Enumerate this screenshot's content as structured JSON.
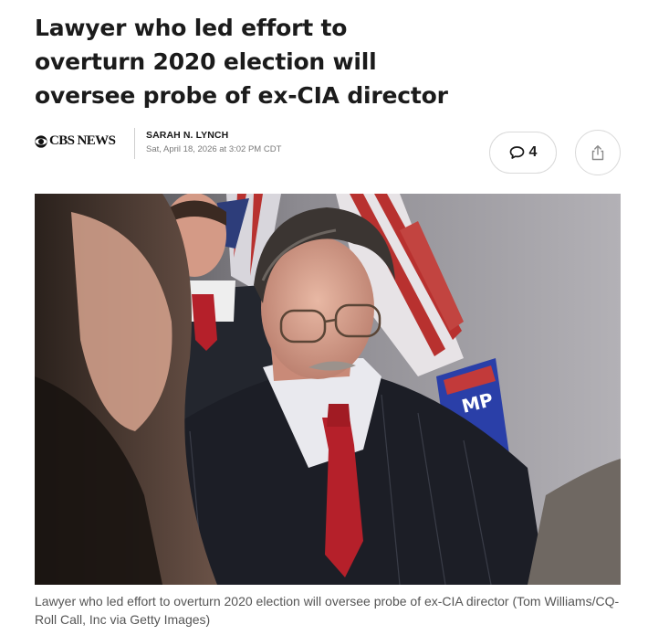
{
  "article": {
    "headline": "Lawyer who led effort to overturn 2020 election will oversee probe of ex-CIA director",
    "publisher": "CBS NEWS",
    "author": "SARAH N. LYNCH",
    "date": "Sat, April 18, 2026 at 3:02 PM CDT",
    "comment_count": "4",
    "image_caption": "Lawyer who led effort to overturn 2020 election will oversee probe of ex-CIA director (Tom Williams/CQ-Roll Call, Inc via Getty Images)"
  },
  "icons": {
    "publisher_logo": "cbs-eye-icon",
    "comments": "speech-bubble-icon",
    "share": "share-icon"
  },
  "colors": {
    "sign_blue": "#2a3fa8",
    "tie_red": "#b5202a",
    "flag_red": "#b8312f"
  }
}
